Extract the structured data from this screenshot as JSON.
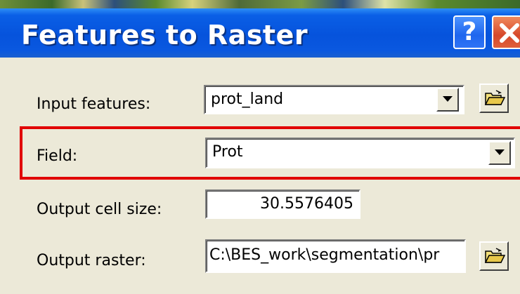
{
  "dialog": {
    "title": "Features to Raster",
    "help_label": "?"
  },
  "form": {
    "input_features": {
      "label": "Input features:",
      "value": "prot_land"
    },
    "field": {
      "label": "Field:",
      "value": "Prot"
    },
    "output_cell_size": {
      "label": "Output cell size:",
      "value": "30.5576405"
    },
    "output_raster": {
      "label": "Output raster:",
      "value": "C:\\BES_work\\segmentation\\pr"
    }
  },
  "colors": {
    "titlebar": "#0653dc",
    "highlight_border": "#e10000",
    "dialog_background": "#ece9d8"
  },
  "icons": [
    "help-icon",
    "close-icon",
    "dropdown-arrow-icon",
    "open-folder-icon"
  ]
}
